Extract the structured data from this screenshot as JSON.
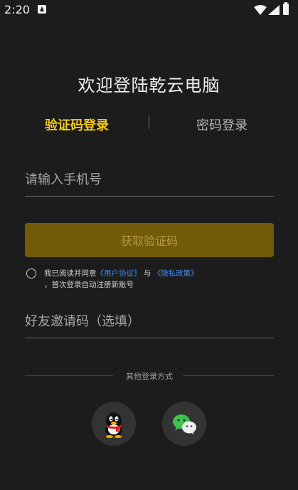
{
  "status_bar": {
    "time": "2:20"
  },
  "title": "欢迎登陆乾云电脑",
  "tabs": [
    {
      "label": "验证码登录",
      "active": true
    },
    {
      "label": "密码登录",
      "active": false
    }
  ],
  "phone_input": {
    "placeholder": "请输入手机号",
    "value": ""
  },
  "get_code_button": "获取验证码",
  "agreement": {
    "prefix": "我已阅读并同意",
    "user_agreement": "《用户协议》",
    "and": "与",
    "privacy_policy": "《隐私政策》",
    "suffix": "，首次登录自动注册新账号"
  },
  "invite_input": {
    "placeholder": "好友邀请码（选填）",
    "value": ""
  },
  "other_login": {
    "label": "其他登录方式"
  },
  "colors": {
    "accent": "#f3c91c",
    "button_bg": "#715b08",
    "link": "#3f8cf0",
    "background": "#1c1c1c"
  },
  "icons": {
    "qq": "qq-icon",
    "wechat": "wechat-icon"
  }
}
